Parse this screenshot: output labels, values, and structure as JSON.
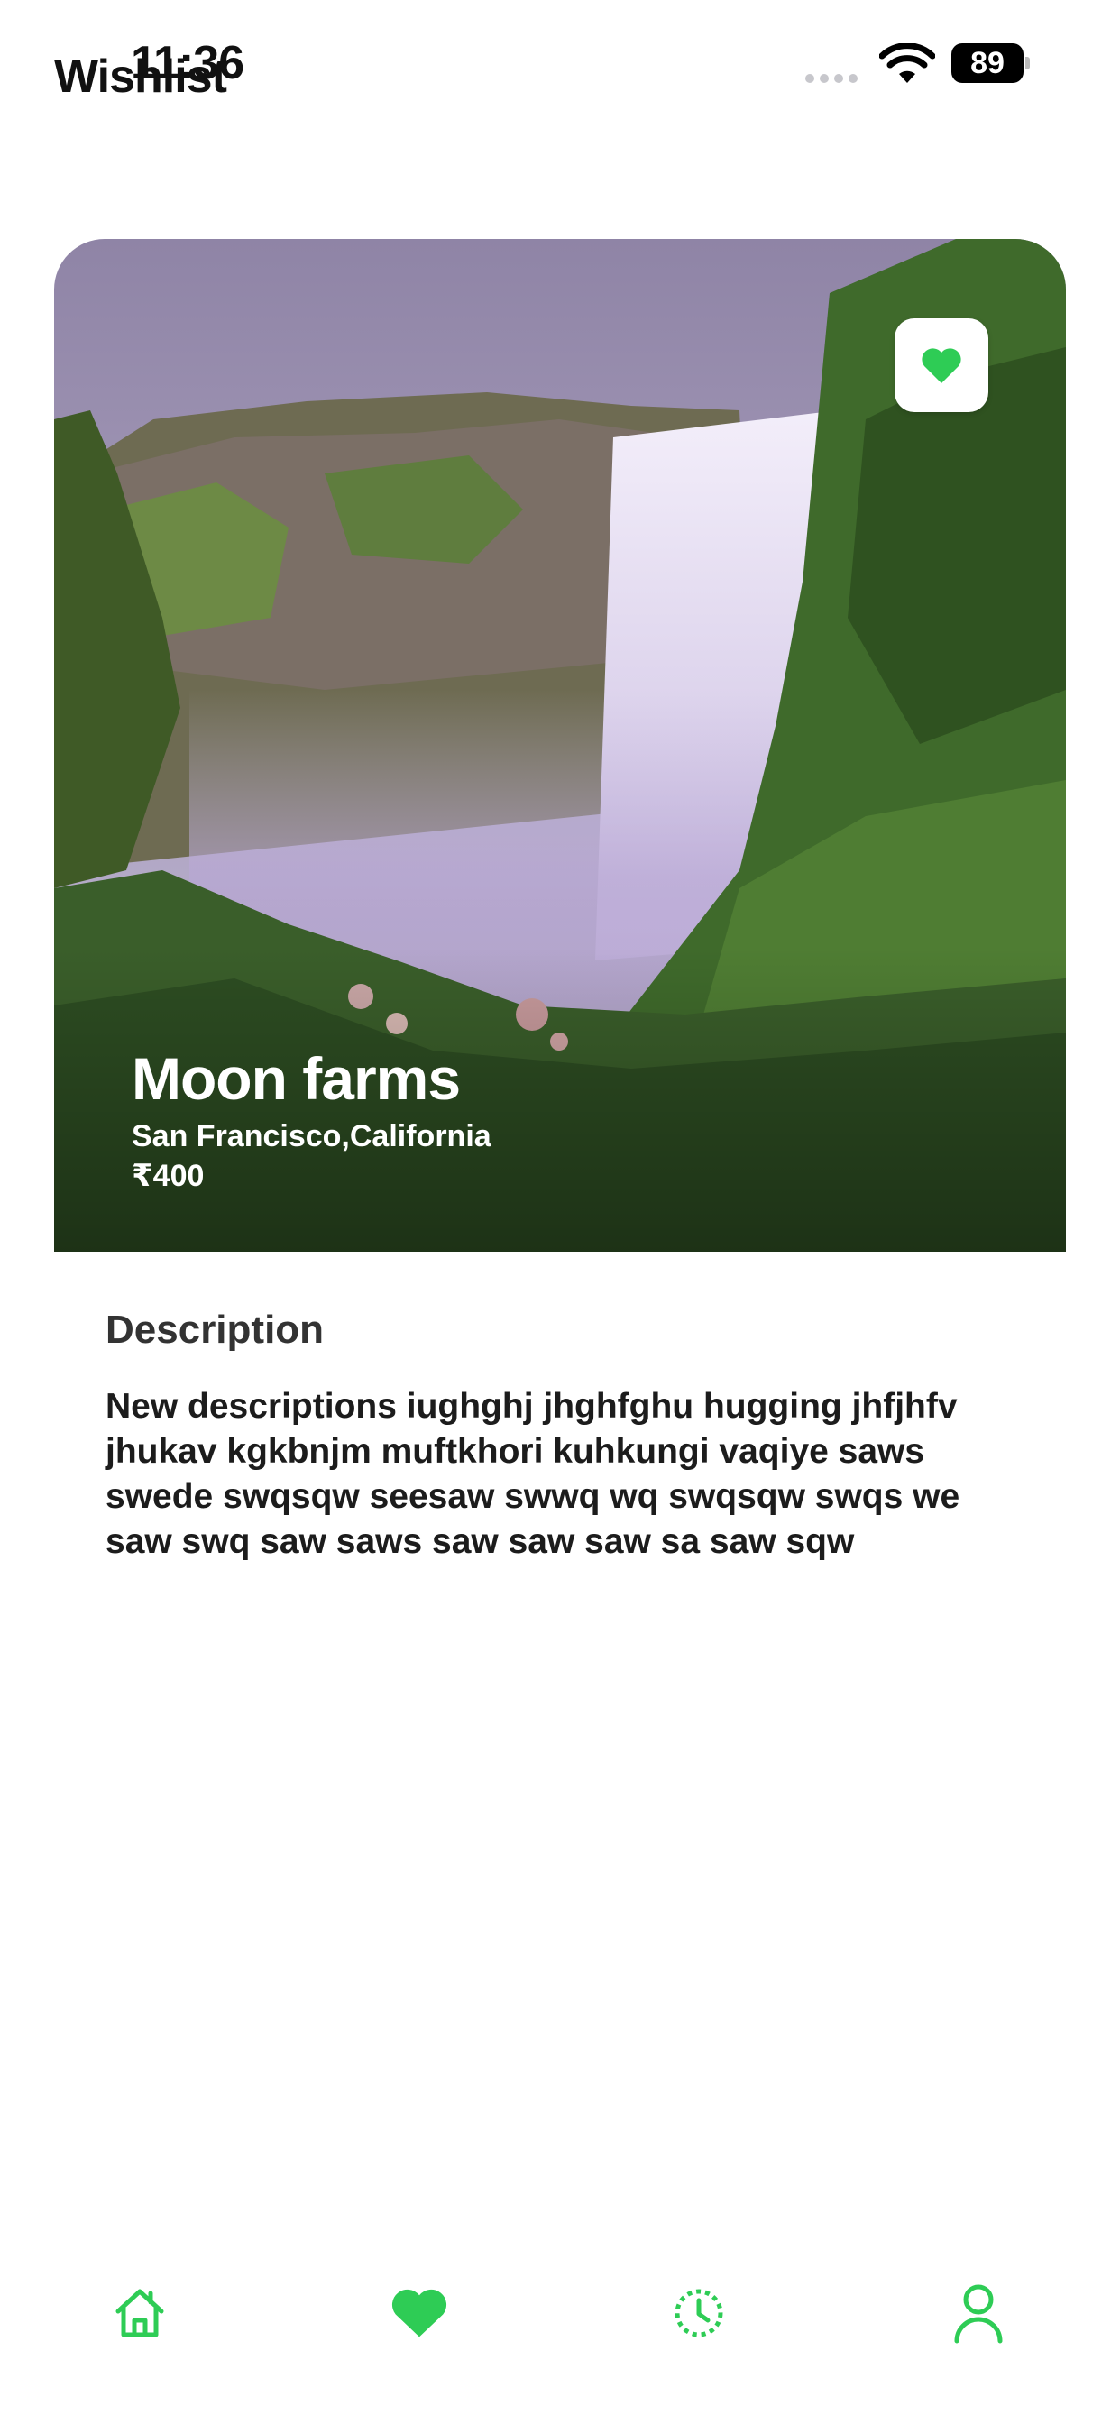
{
  "status_bar": {
    "time": "11:36",
    "battery": "89"
  },
  "page": {
    "title": "Wishlist"
  },
  "hero": {
    "title": "Moon farms",
    "location": "San Francisco,California",
    "price": "₹400",
    "wishlisted": true
  },
  "description": {
    "heading": "Description",
    "body": "New descriptions iughghj jhghfghu hugging jhfjhfv jhukav kgkbnjm muftkhori kuhkungi vaqiye saws swede swqsqw seesaw swwq wq swqsqw swqs we saw swq saw saws saw saw saw sa saw sqw"
  },
  "bottom_nav": {
    "items": [
      {
        "icon": "home-icon",
        "active": false
      },
      {
        "icon": "heart-icon",
        "active": true
      },
      {
        "icon": "clock-icon",
        "active": false
      },
      {
        "icon": "user-icon",
        "active": false
      }
    ]
  },
  "colors": {
    "accent": "#2ecc55",
    "text": "#111111",
    "heading": "#333333"
  }
}
